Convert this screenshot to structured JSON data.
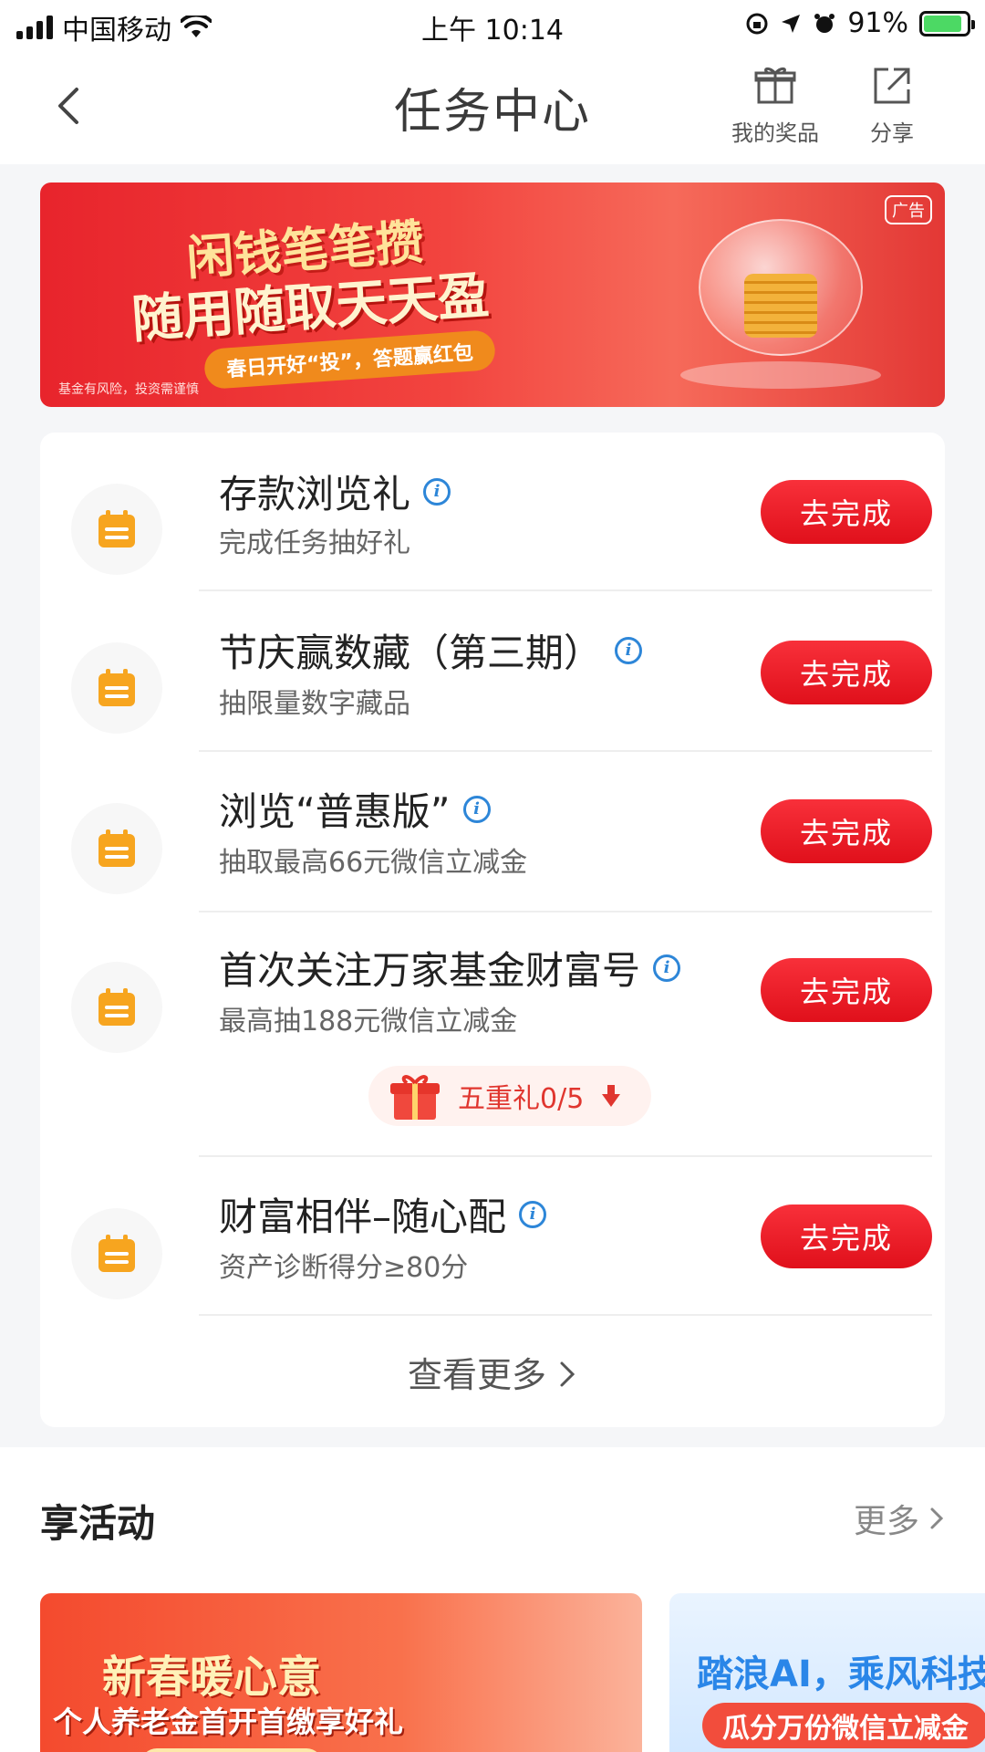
{
  "status_bar": {
    "carrier": "中国移动",
    "time": "上午 10:14",
    "battery": "91%"
  },
  "header": {
    "title": "任务中心",
    "my_prizes": "我的奖品",
    "share": "分享"
  },
  "banner": {
    "ad_tag": "广告",
    "line1": "闲钱笔笔攒",
    "line2": "随用随取天天盈",
    "line3": "春日开好“投”，答题赢红包",
    "risk_note": "基金有风险，投资需谨慎"
  },
  "tasks": [
    {
      "title": "存款浏览礼",
      "subtitle": "完成任务抽好礼",
      "button": "去完成"
    },
    {
      "title": "节庆赢数藏（第三期）",
      "subtitle": "抽限量数字藏品",
      "button": "去完成"
    },
    {
      "title": "浏览“普惠版”",
      "subtitle": "抽取最高66元微信立减金",
      "button": "去完成"
    },
    {
      "title": "首次关注万家基金财富号",
      "subtitle": "最高抽188元微信立减金",
      "button": "去完成"
    },
    {
      "title": "财富相伴–随心配",
      "subtitle": "资产诊断得分≥80分",
      "button": "去完成"
    }
  ],
  "gift_progress": {
    "label": "五重礼0/5"
  },
  "see_more": "查看更多",
  "activities": {
    "section_title": "享活动",
    "more": "更多",
    "card1": {
      "headline": "新春暖心意",
      "subline": "个人养老金首开首缴享好礼"
    },
    "card2": {
      "headline": "踏浪AI，乘风科技",
      "subline": "瓜分万份微信立减金"
    }
  },
  "colors": {
    "primary_red": "#e8141d",
    "info_blue": "#2d86d8",
    "icon_orange": "#f7a51f"
  }
}
